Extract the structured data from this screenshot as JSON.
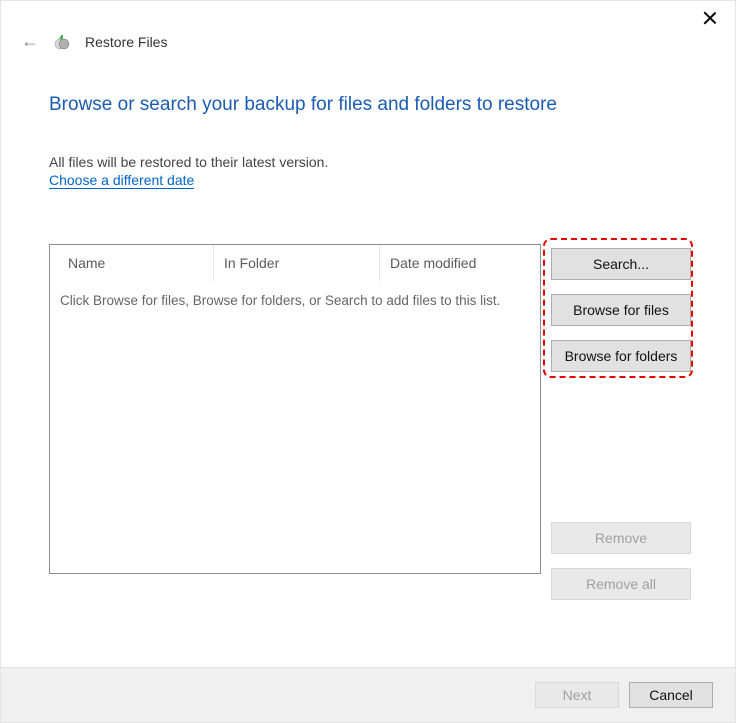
{
  "window": {
    "title": "Restore Files"
  },
  "heading": "Browse or search your backup for files and folders to restore",
  "subtext": "All files will be restored to their latest version.",
  "link": "Choose a different date",
  "list": {
    "columns": {
      "name": "Name",
      "folder": "In Folder",
      "date": "Date modified"
    },
    "empty_text": "Click Browse for files, Browse for folders, or Search to add files to this list."
  },
  "buttons": {
    "search": "Search...",
    "browse_files": "Browse for files",
    "browse_folders": "Browse for folders",
    "remove": "Remove",
    "remove_all": "Remove all",
    "next": "Next",
    "cancel": "Cancel"
  }
}
